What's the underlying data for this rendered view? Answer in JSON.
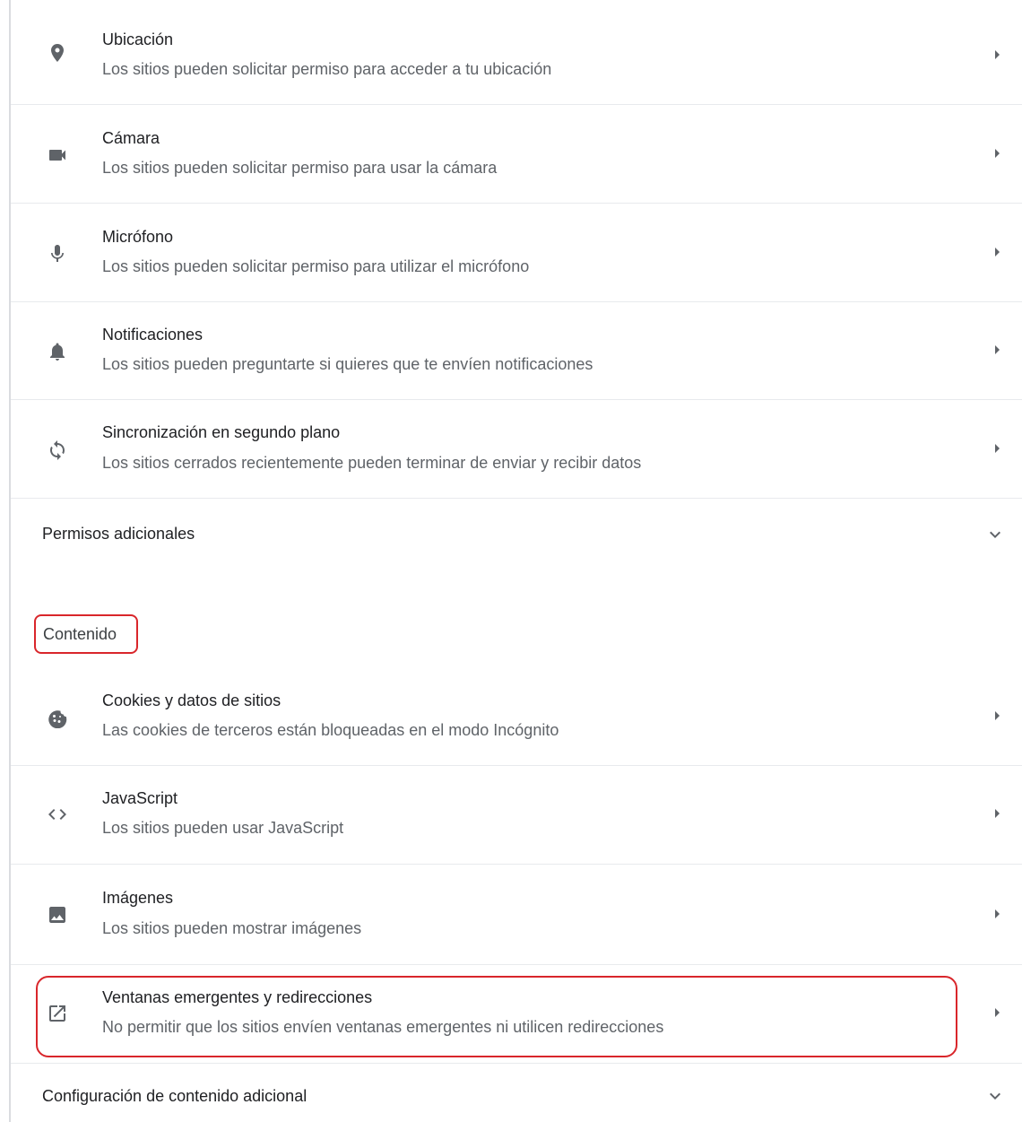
{
  "permissions": [
    {
      "icon": "location-pin-icon",
      "title": "Ubicación",
      "subtitle": "Los sitios pueden solicitar permiso para acceder a tu ubicación"
    },
    {
      "icon": "camera-icon",
      "title": "Cámara",
      "subtitle": "Los sitios pueden solicitar permiso para usar la cámara"
    },
    {
      "icon": "microphone-icon",
      "title": "Micrófono",
      "subtitle": "Los sitios pueden solicitar permiso para utilizar el micrófono"
    },
    {
      "icon": "bell-icon",
      "title": "Notificaciones",
      "subtitle": "Los sitios pueden preguntarte si quieres que te envíen notificaciones"
    },
    {
      "icon": "sync-icon",
      "title": "Sincronización en segundo plano",
      "subtitle": "Los sitios cerrados recientemente pueden terminar de enviar y recibir datos"
    }
  ],
  "additional_permissions_label": "Permisos adicionales",
  "content_heading": "Contenido",
  "content": [
    {
      "icon": "cookie-icon",
      "title": "Cookies y datos de sitios",
      "subtitle": "Las cookies de terceros están bloqueadas en el modo Incógnito"
    },
    {
      "icon": "code-icon",
      "title": "JavaScript",
      "subtitle": "Los sitios pueden usar JavaScript"
    },
    {
      "icon": "image-icon",
      "title": "Imágenes",
      "subtitle": "Los sitios pueden mostrar imágenes"
    },
    {
      "icon": "open-in-new-icon",
      "title": "Ventanas emergentes y redirecciones",
      "subtitle": "No permitir que los sitios envíen ventanas emergentes ni utilicen redirecciones"
    }
  ],
  "additional_content_label": "Configuración de contenido adicional",
  "highlight_color": "#d9262b"
}
